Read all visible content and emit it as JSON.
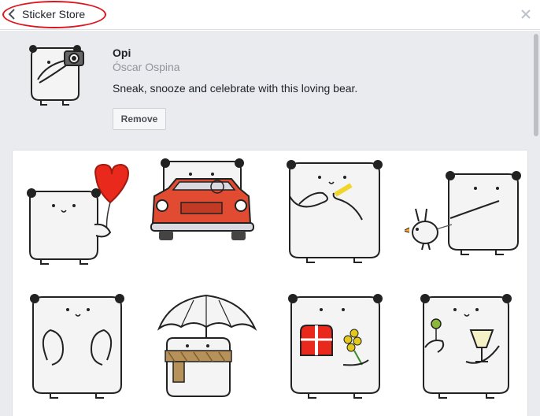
{
  "header": {
    "back_label": "Sticker Store",
    "back_icon": "chevron-left-icon",
    "close_icon": "close-icon"
  },
  "pack": {
    "title": "Opi",
    "author": "Óscar Ospina",
    "description": "Sneak, snooze and celebrate with this loving bear.",
    "remove_label": "Remove"
  },
  "stickers": [
    "bear-with-heart-balloon",
    "bear-driving-red-car",
    "bear-with-yellow-pencil",
    "bear-walking-bird",
    "bear-hands-up",
    "bear-with-umbrella-and-scarf",
    "bear-with-gift-and-flowers",
    "bear-with-cocktail-drink"
  ],
  "colors": {
    "highlight_ring": "#e0141e",
    "panel_background": "#e9ebee",
    "heart": "#e8291c",
    "car": "#e14b32",
    "pencil": "#f1d52b",
    "flowers": "#e3c91c",
    "scarf": "#b6915a"
  }
}
